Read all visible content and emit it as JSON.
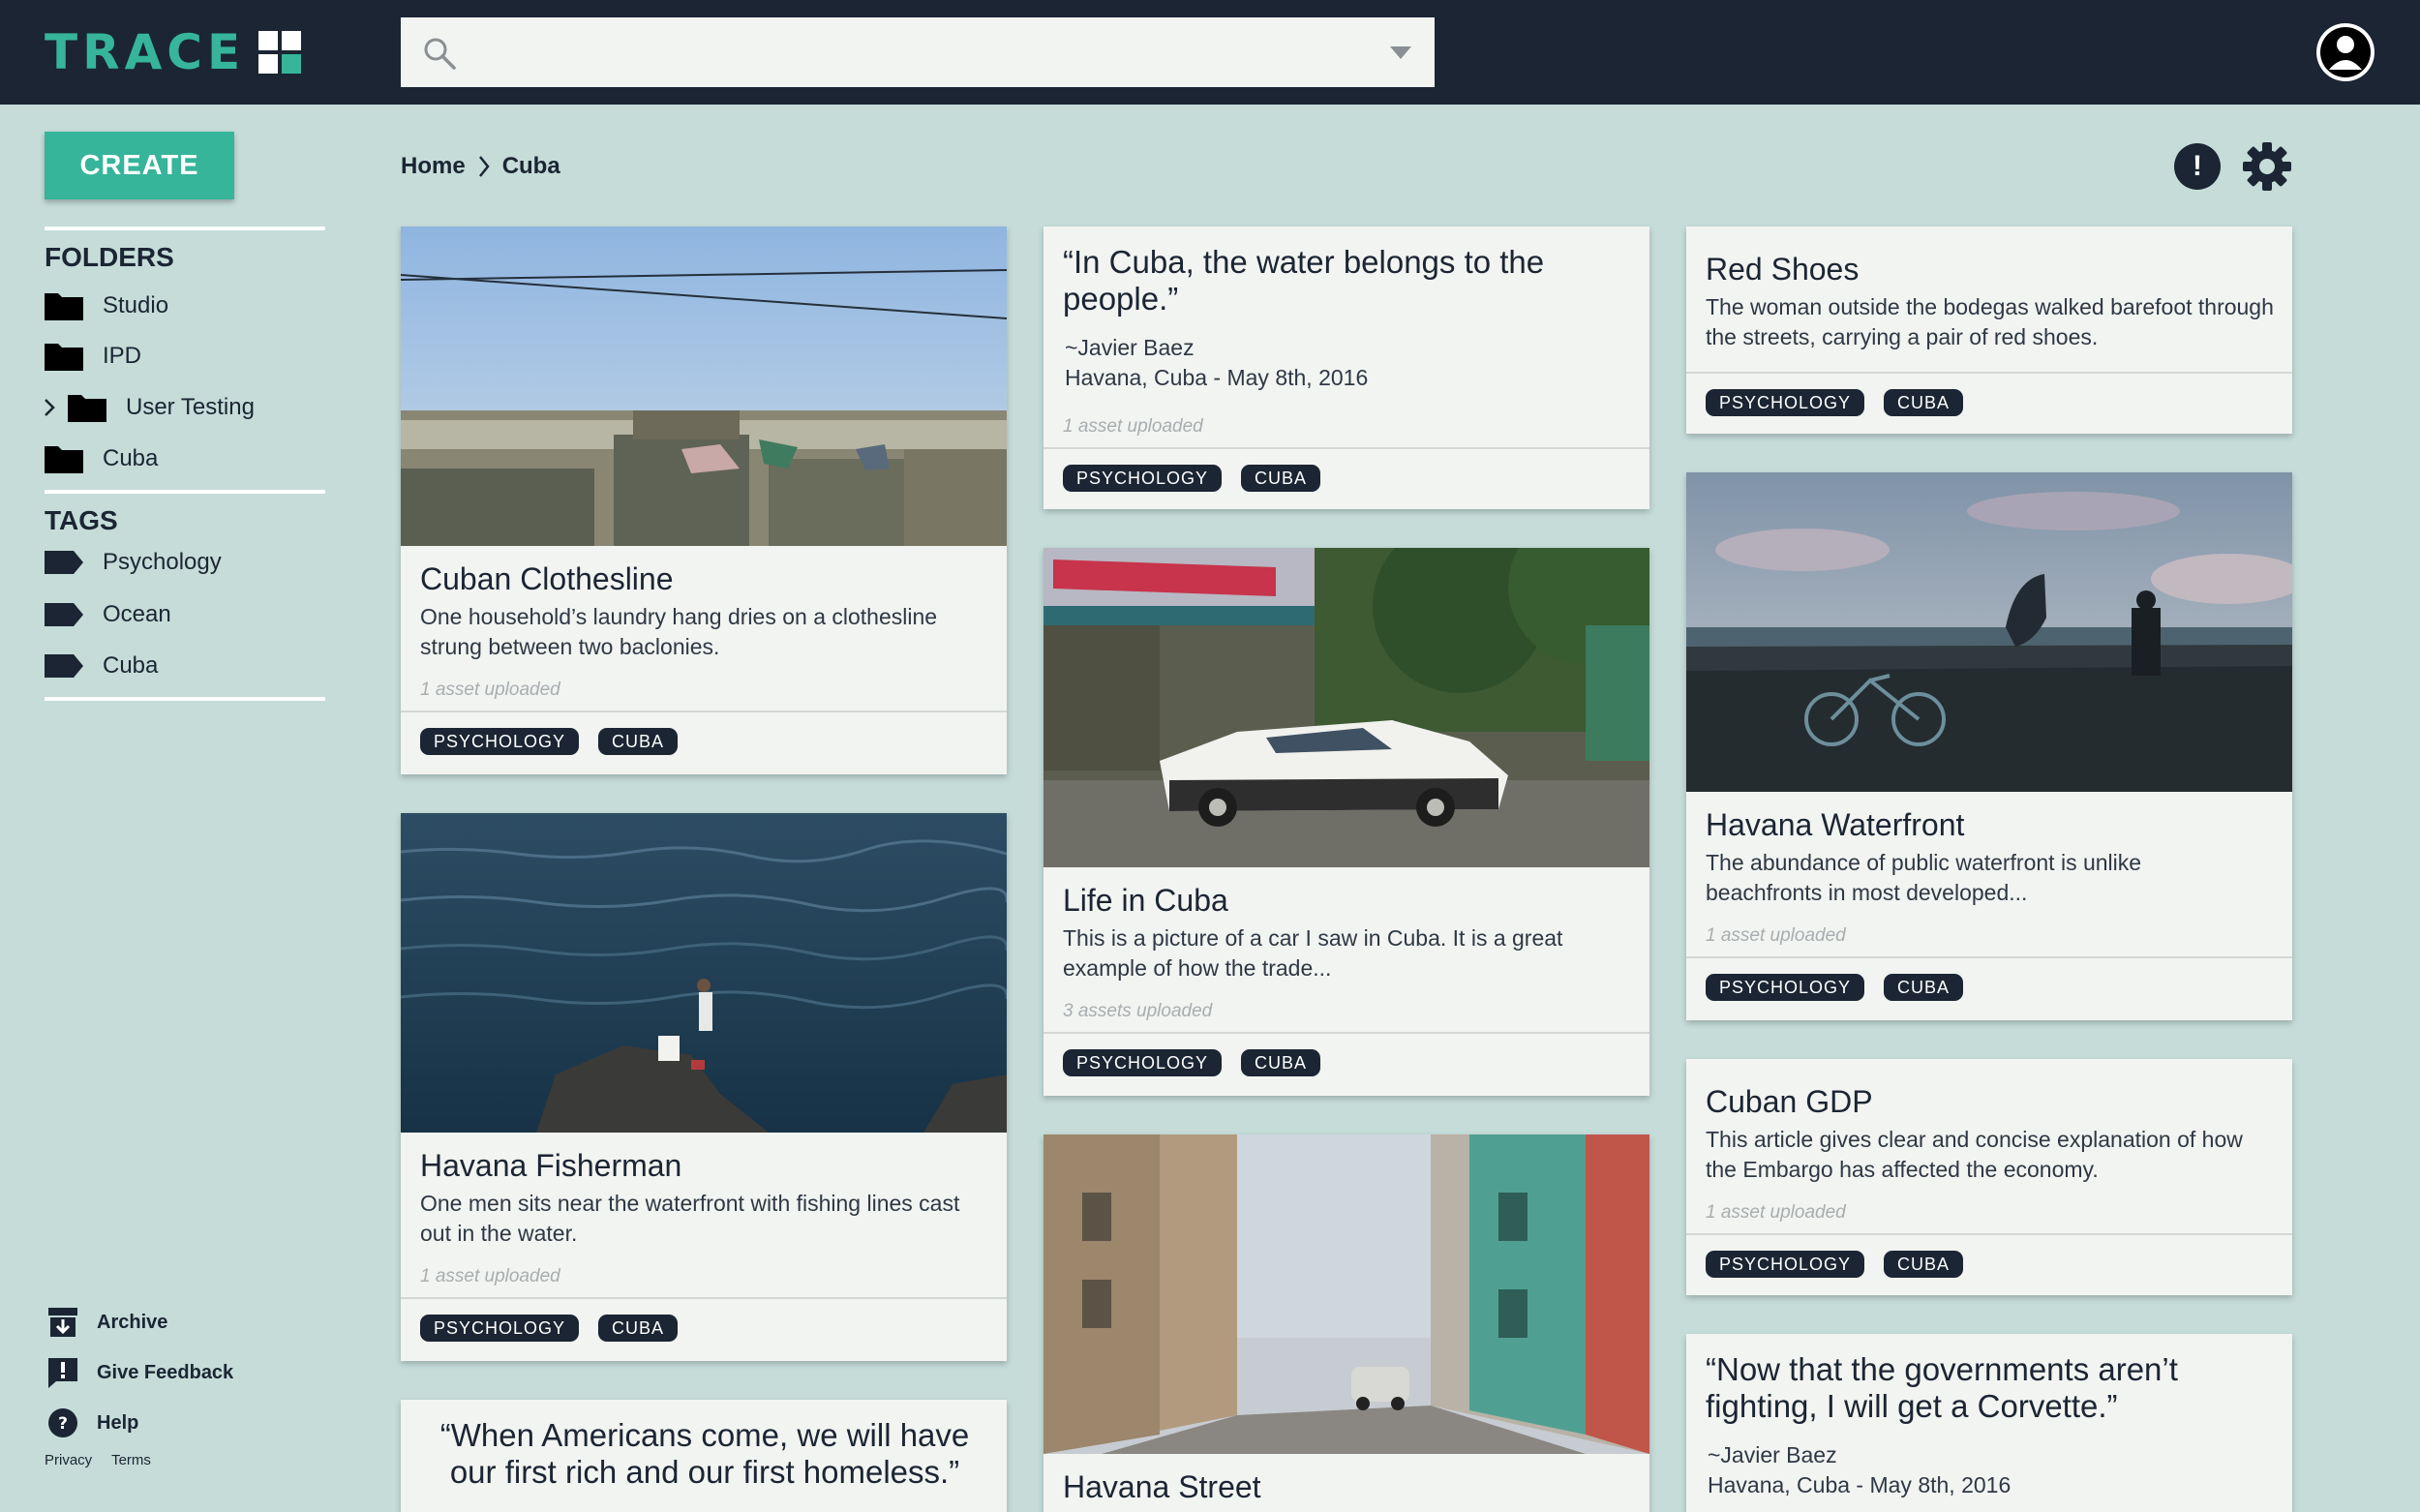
{
  "app": {
    "logo_text": "TRACE"
  },
  "search": {
    "placeholder": "",
    "value": ""
  },
  "sidebar": {
    "create_label": "CREATE",
    "folders_heading": "FOLDERS",
    "folders": [
      {
        "label": "Studio"
      },
      {
        "label": "IPD"
      },
      {
        "label": "User Testing"
      },
      {
        "label": "Cuba"
      }
    ],
    "tags_heading": "TAGS",
    "tags": [
      {
        "label": "Psychology"
      },
      {
        "label": "Ocean"
      },
      {
        "label": "Cuba"
      }
    ],
    "footer": [
      {
        "label": "Archive"
      },
      {
        "label": "Give Feedback"
      },
      {
        "label": "Help"
      }
    ],
    "legal": {
      "privacy": "Privacy",
      "terms": "Terms"
    }
  },
  "breadcrumb": {
    "home": "Home",
    "current": "Cuba"
  },
  "actions": {
    "alert_symbol": "!"
  },
  "cards": {
    "clothesline": {
      "title": "Cuban Clothesline",
      "desc": "One household’s laundry hang dries on a clothesline strung between two baclonies.",
      "meta": "1 asset uploaded",
      "tags": [
        "PSYCHOLOGY",
        "CUBA"
      ]
    },
    "fisherman": {
      "title": "Havana Fisherman",
      "desc": "One men sits near the waterfront with fishing lines cast out in the water.",
      "meta": "1 asset uploaded",
      "tags": [
        "PSYCHOLOGY",
        "CUBA"
      ]
    },
    "quote_americans": {
      "quote": "“When Americans come, we will have our first rich and our first homeless.”"
    },
    "quote_water": {
      "quote": "“In Cuba, the water belongs to the people.”",
      "author": "~Javier Baez",
      "place": "Havana, Cuba - May 8th, 2016",
      "meta": "1 asset uploaded",
      "tags": [
        "PSYCHOLOGY",
        "CUBA"
      ]
    },
    "life": {
      "title": "Life in Cuba",
      "desc": "This is a picture of a car I saw in Cuba.  It is a great example of how the trade...",
      "meta": "3 assets uploaded",
      "tags": [
        "PSYCHOLOGY",
        "CUBA"
      ]
    },
    "street": {
      "title": "Havana Street"
    },
    "shoes": {
      "title": "Red Shoes",
      "desc": "The woman outside the bodegas walked barefoot through the streets, carrying a pair of red shoes.",
      "tags": [
        "PSYCHOLOGY",
        "CUBA"
      ]
    },
    "waterfront": {
      "title": "Havana Waterfront",
      "desc": "The abundance of public waterfront is unlike beachfronts in most developed...",
      "meta": "1 asset uploaded",
      "tags": [
        "PSYCHOLOGY",
        "CUBA"
      ]
    },
    "gdp": {
      "title": "Cuban GDP",
      "desc": "This article gives clear and concise explanation of how the Embargo has affected the economy.",
      "meta": "1 asset uploaded",
      "tags": [
        "PSYCHOLOGY",
        "CUBA"
      ]
    },
    "quote_corvette": {
      "quote": "“Now that the governments aren’t fighting, I will get a Corvette.”",
      "author": "~Javier Baez",
      "place": "Havana, Cuba - May 8th, 2016"
    }
  },
  "colors": {
    "background": "#c5dcd8",
    "topbar": "#1b2533",
    "accent": "#36b59a",
    "card": "#f2f4f1",
    "tag": "#1b2533"
  },
  "icons": [
    "search-icon",
    "dropdown-icon",
    "user-avatar-icon",
    "folder-icon",
    "tag-icon",
    "chevron-right-icon",
    "archive-icon",
    "feedback-icon",
    "help-icon",
    "alert-icon",
    "gear-icon"
  ]
}
